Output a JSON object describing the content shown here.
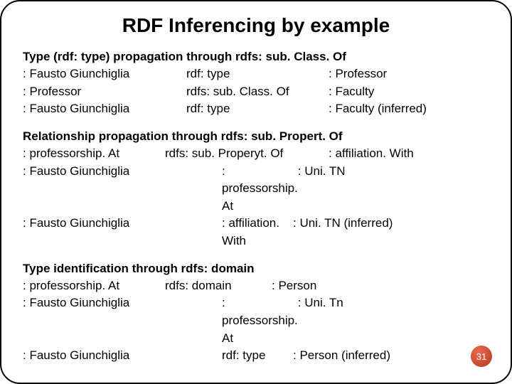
{
  "title": "RDF Inferencing by example",
  "section1": {
    "heading": "Type (rdf: type) propagation through rdfs: sub. Class. Of",
    "rows": [
      {
        "c1": ": Fausto Giunchiglia",
        "c2": "rdf: type",
        "c3": ": Professor"
      },
      {
        "c1": ": Professor",
        "c2": "rdfs: sub. Class. Of",
        "c3": ": Faculty"
      },
      {
        "c1": ": Fausto Giunchiglia",
        "c2": "rdf: type",
        "c3": ": Faculty (inferred)"
      }
    ]
  },
  "section2": {
    "heading": "Relationship propagation through rdfs: sub. Propert. Of",
    "row0": {
      "c1": ": professorship. At",
      "c2": "rdfs: sub. Properyt. Of",
      "c3": ": affiliation. With"
    },
    "row1": {
      "c1": ": Fausto Giunchiglia",
      "c2": ": professorship. At",
      "c3": ": Uni. TN"
    },
    "row2": {
      "c1": ": Fausto Giunchiglia",
      "c2": ": affiliation. With",
      "c3": ": Uni. TN (inferred)"
    }
  },
  "section3": {
    "heading": "Type identification through rdfs: domain",
    "row0": {
      "c1": ": professorship. At",
      "c2": "rdfs: domain",
      "c3": ": Person"
    },
    "row1": {
      "c1": ": Fausto Giunchiglia",
      "c2": ": professorship. At",
      "c3": ": Uni. Tn"
    },
    "row2": {
      "c1": ": Fausto Giunchiglia",
      "c2": "rdf: type",
      "c3": ": Person (inferred)"
    }
  },
  "pageNumber": "31"
}
